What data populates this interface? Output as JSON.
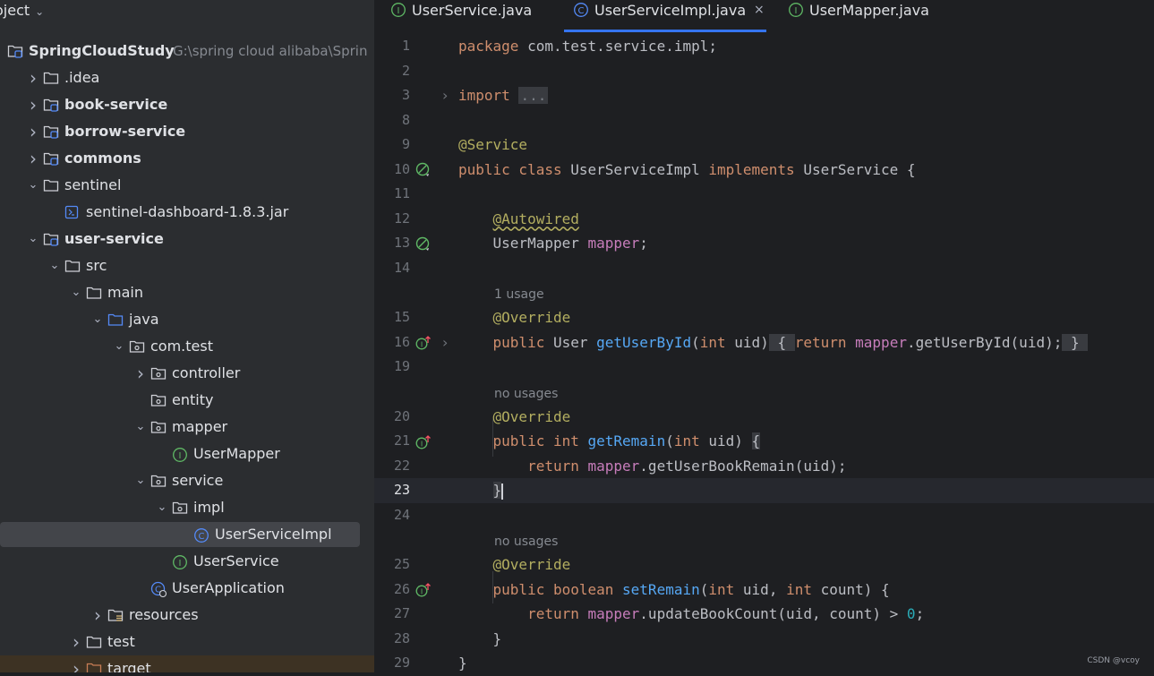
{
  "sidebar": {
    "title": "oject",
    "tree": [
      {
        "label": "SpringCloudStudy",
        "path": "G:\\spring cloud alibaba\\Sprin",
        "bold": true,
        "icon": "module-folder"
      },
      {
        "label": ".idea",
        "bold": false,
        "icon": "folder",
        "chev": "right"
      },
      {
        "label": "book-service",
        "bold": true,
        "icon": "module-folder",
        "chev": "right"
      },
      {
        "label": "borrow-service",
        "bold": true,
        "icon": "module-folder",
        "chev": "right"
      },
      {
        "label": "commons",
        "bold": true,
        "icon": "module-folder",
        "chev": "right"
      },
      {
        "label": "sentinel",
        "bold": false,
        "icon": "folder",
        "chev": "down"
      },
      {
        "label": "sentinel-dashboard-1.8.3.jar",
        "bold": false,
        "icon": "jar"
      },
      {
        "label": "user-service",
        "bold": true,
        "icon": "module-folder",
        "chev": "down"
      },
      {
        "label": "src",
        "bold": false,
        "icon": "folder",
        "chev": "down"
      },
      {
        "label": "main",
        "bold": false,
        "icon": "folder",
        "chev": "down"
      },
      {
        "label": "java",
        "bold": false,
        "icon": "source-folder",
        "chev": "down"
      },
      {
        "label": "com.test",
        "bold": false,
        "icon": "package",
        "chev": "down"
      },
      {
        "label": "controller",
        "bold": false,
        "icon": "package",
        "chev": "right"
      },
      {
        "label": "entity",
        "bold": false,
        "icon": "package"
      },
      {
        "label": "mapper",
        "bold": false,
        "icon": "package",
        "chev": "down"
      },
      {
        "label": "UserMapper",
        "bold": false,
        "icon": "interface"
      },
      {
        "label": "service",
        "bold": false,
        "icon": "package",
        "chev": "down"
      },
      {
        "label": "impl",
        "bold": false,
        "icon": "package",
        "chev": "down"
      },
      {
        "label": "UserServiceImpl",
        "bold": false,
        "icon": "class",
        "selected": true
      },
      {
        "label": "UserService",
        "bold": false,
        "icon": "interface"
      },
      {
        "label": "UserApplication",
        "bold": false,
        "icon": "spring-class"
      },
      {
        "label": "resources",
        "bold": false,
        "icon": "resources-folder",
        "chev": "right"
      },
      {
        "label": "test",
        "bold": false,
        "icon": "folder",
        "chev": "right"
      },
      {
        "label": "target",
        "bold": false,
        "icon": "excluded-folder",
        "chev": "right"
      }
    ]
  },
  "tabs": [
    {
      "label": "UserService.java",
      "icon": "interface",
      "active": false
    },
    {
      "label": "UserServiceImpl.java",
      "icon": "class",
      "active": true,
      "close": "×"
    },
    {
      "label": "UserMapper.java",
      "icon": "interface",
      "active": false
    }
  ],
  "code": {
    "lines": [
      {
        "n": "1",
        "html": "<span class=\"kw\">package</span> com.test.service.impl;"
      },
      {
        "n": "2",
        "html": ""
      },
      {
        "n": "3",
        "html": "<span class=\"kw\">import</span> <span class=\"fold-box\">...</span>",
        "fold": true
      },
      {
        "n": "8",
        "html": ""
      },
      {
        "n": "9",
        "html": "<span class=\"ann\">@Service</span>"
      },
      {
        "n": "10",
        "html": "<span class=\"kw\">public class</span> UserServiceImpl <span class=\"kw\">implements</span> UserService {",
        "gutter": "bean"
      },
      {
        "n": "11",
        "html": ""
      },
      {
        "n": "12",
        "html": "    <span class=\"ann squig\">@Autowired</span>"
      },
      {
        "n": "13",
        "html": "    UserMapper <span class=\"fld\">mapper</span>;",
        "gutter": "bean2"
      },
      {
        "n": "14",
        "html": ""
      },
      {
        "hint": "1 usage"
      },
      {
        "n": "15",
        "html": "    <span class=\"ann\">@Override</span>"
      },
      {
        "n": "16",
        "html": "    <span class=\"kw\">public</span> User <span class=\"mth\">getUserById</span>(<span class=\"kw\">int</span> uid)<span class=\"bracebox\"> { </span><span class=\"kw\">return</span> <span class=\"fld\">mapper</span>.getUserById(uid);<span class=\"bracebox\"> } </span>",
        "gutter": "impl",
        "fold": true
      },
      {
        "n": "19",
        "html": ""
      },
      {
        "hint": "no usages"
      },
      {
        "n": "20",
        "html": "    <span class=\"ann\">@Override</span>"
      },
      {
        "n": "21",
        "html": "    <span class=\"kw\">public int</span> <span class=\"mth\">getRemain</span>(<span class=\"kw\">int</span> uid) <span class=\"bracebox\">{</span>",
        "gutter": "impl"
      },
      {
        "n": "22",
        "html": "        <span class=\"kw\">return</span> <span class=\"fld\">mapper</span>.getUserBookRemain(uid);"
      },
      {
        "n": "23",
        "html": "    <span class=\"bracebox\">}</span><span class=\"caret\"></span>",
        "current": true
      },
      {
        "n": "24",
        "html": ""
      },
      {
        "hint": "no usages"
      },
      {
        "n": "25",
        "html": "    <span class=\"ann\">@Override</span>"
      },
      {
        "n": "26",
        "html": "    <span class=\"kw\">public boolean</span> <span class=\"mth\">setRemain</span>(<span class=\"kw\">int</span> uid, <span class=\"kw\">int</span> count) {",
        "gutter": "impl"
      },
      {
        "n": "27",
        "html": "        <span class=\"kw\">return</span> <span class=\"fld\">mapper</span>.updateBookCount(uid, count) &gt; <span class=\"num\">0</span>;"
      },
      {
        "n": "28",
        "html": "    }"
      },
      {
        "n": "29",
        "html": "}"
      }
    ]
  },
  "watermark": "CSDN @vcoy",
  "colors": {
    "sidebar_bg": "#2b2d30",
    "editor_bg": "#1e1f22",
    "accent": "#3574f0",
    "keyword": "#cf8e6d",
    "annotation": "#b3ae60",
    "field": "#c77dbb",
    "method": "#56a8f5"
  }
}
